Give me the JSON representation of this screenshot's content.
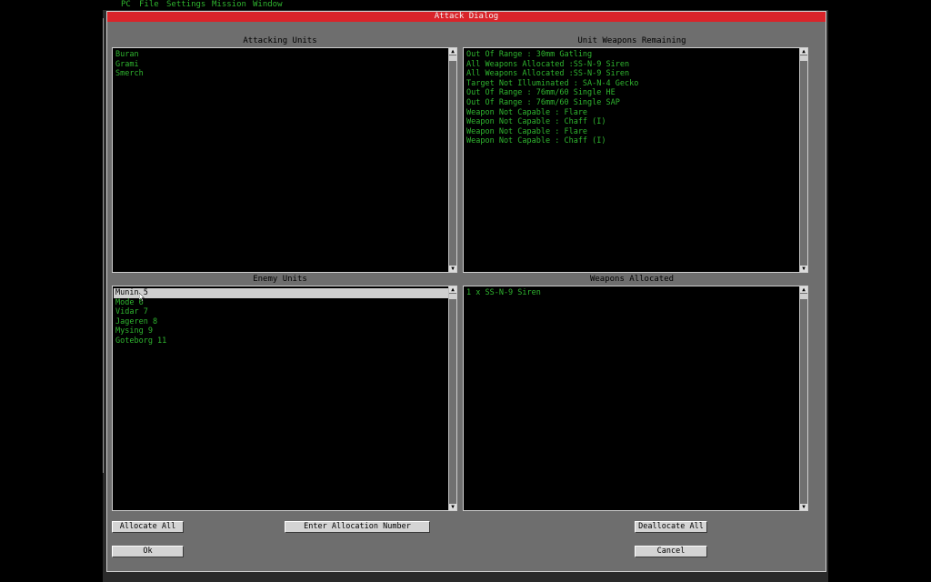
{
  "menu": [
    "PC",
    "File",
    "Settings",
    "Mission",
    "Window"
  ],
  "dialog_title": "Attack Dialog",
  "attacking_units": {
    "title": "Attacking Units",
    "items": [
      "Buran",
      "Grami",
      "Smerch"
    ]
  },
  "unit_weapons": {
    "title": "Unit Weapons Remaining",
    "items": [
      "Out Of Range : 30mm Gatling",
      "All Weapons Allocated :SS-N-9 Siren",
      "All Weapons Allocated :SS-N-9 Siren",
      "Target Not Illuminated : SA-N-4 Gecko",
      "Out Of Range : 76mm/60 Single HE",
      "Out Of Range : 76mm/60 Single SAP",
      "Weapon Not Capable : Flare",
      "Weapon Not Capable : Chaff (I)",
      "Weapon Not Capable : Flare",
      "Weapon Not Capable : Chaff (I)"
    ]
  },
  "enemy_units": {
    "title": "Enemy Units",
    "items": [
      "Munin 5",
      "Mode 6",
      "Vidar 7",
      "Jageren 8",
      "Mysing 9",
      "Goteborg 11"
    ],
    "selected_index": 0
  },
  "weapons_allocated": {
    "title": "Weapons Allocated",
    "items": [
      "1 x SS-N-9 Siren"
    ]
  },
  "buttons": {
    "allocate_all": "Allocate All",
    "enter_allocation": "Enter Allocation Number",
    "deallocate_all": "Deallocate All",
    "ok": "Ok",
    "cancel": "Cancel"
  },
  "colors": {
    "list_text": "#2fb52f",
    "title_bar": "#d9242a",
    "dialog_bg": "#6e6e6e"
  }
}
